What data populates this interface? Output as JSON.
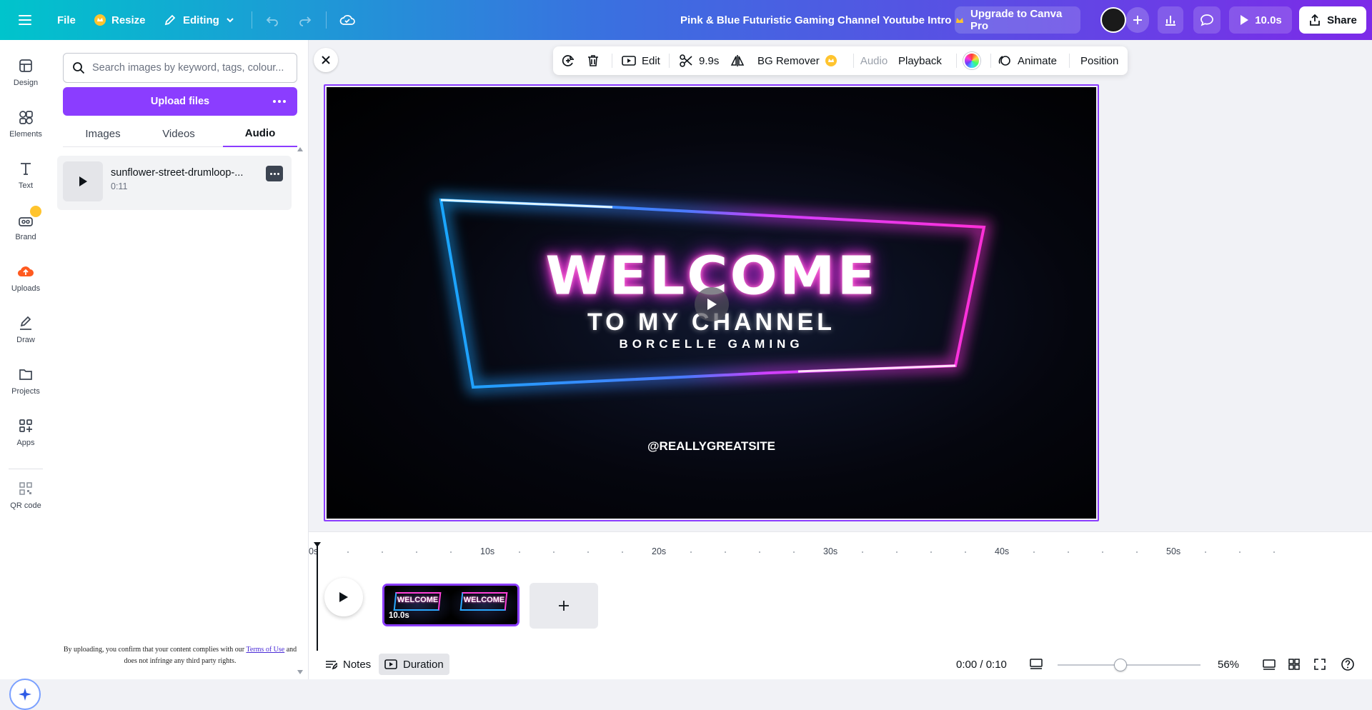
{
  "topbar": {
    "file": "File",
    "resize": "Resize",
    "editing": "Editing",
    "title": "Pink & Blue Futuristic Gaming Channel Youtube Intro",
    "upgrade": "Upgrade to Canva Pro",
    "present": "10.0s",
    "share": "Share"
  },
  "rail": [
    "Design",
    "Elements",
    "Text",
    "Brand",
    "Uploads",
    "Draw",
    "Projects",
    "Apps",
    "QR code"
  ],
  "panel": {
    "search_placeholder": "Search images by keyword, tags, colour...",
    "upload": "Upload files",
    "tabs": [
      "Images",
      "Videos",
      "Audio"
    ],
    "audio_item": {
      "title": "sunflower-street-drumloop-...",
      "duration": "0:11"
    },
    "disclaimer_pre": "By uploading, you confirm that your content complies with our",
    "disclaimer_link": "Terms of Use",
    "disclaimer_post": "and does not infringe any third party rights."
  },
  "toolbar": {
    "edit": "Edit",
    "trim": "9.9s",
    "bg_remover": "BG Remover",
    "audio": "Audio",
    "playback": "Playback",
    "animate": "Animate",
    "position": "Position"
  },
  "canvas": {
    "welcome": "WELCOME",
    "subtitle": "TO MY CHANNEL",
    "brand": "BORCELLE GAMING",
    "handle": "@REALLYGREATSITE"
  },
  "timeline": {
    "ticks": [
      "0s",
      "10s",
      "20s",
      "30s",
      "40s",
      "50s"
    ],
    "clip_duration": "10.0s",
    "thumb_text": "WELCOME"
  },
  "bottom": {
    "notes": "Notes",
    "duration": "Duration",
    "time": "0:00 / 0:10",
    "zoom": "56%"
  },
  "colors": {
    "accent": "#8b3dff",
    "gradient_start": "#00c4cc",
    "gradient_end": "#7c2ae8"
  }
}
